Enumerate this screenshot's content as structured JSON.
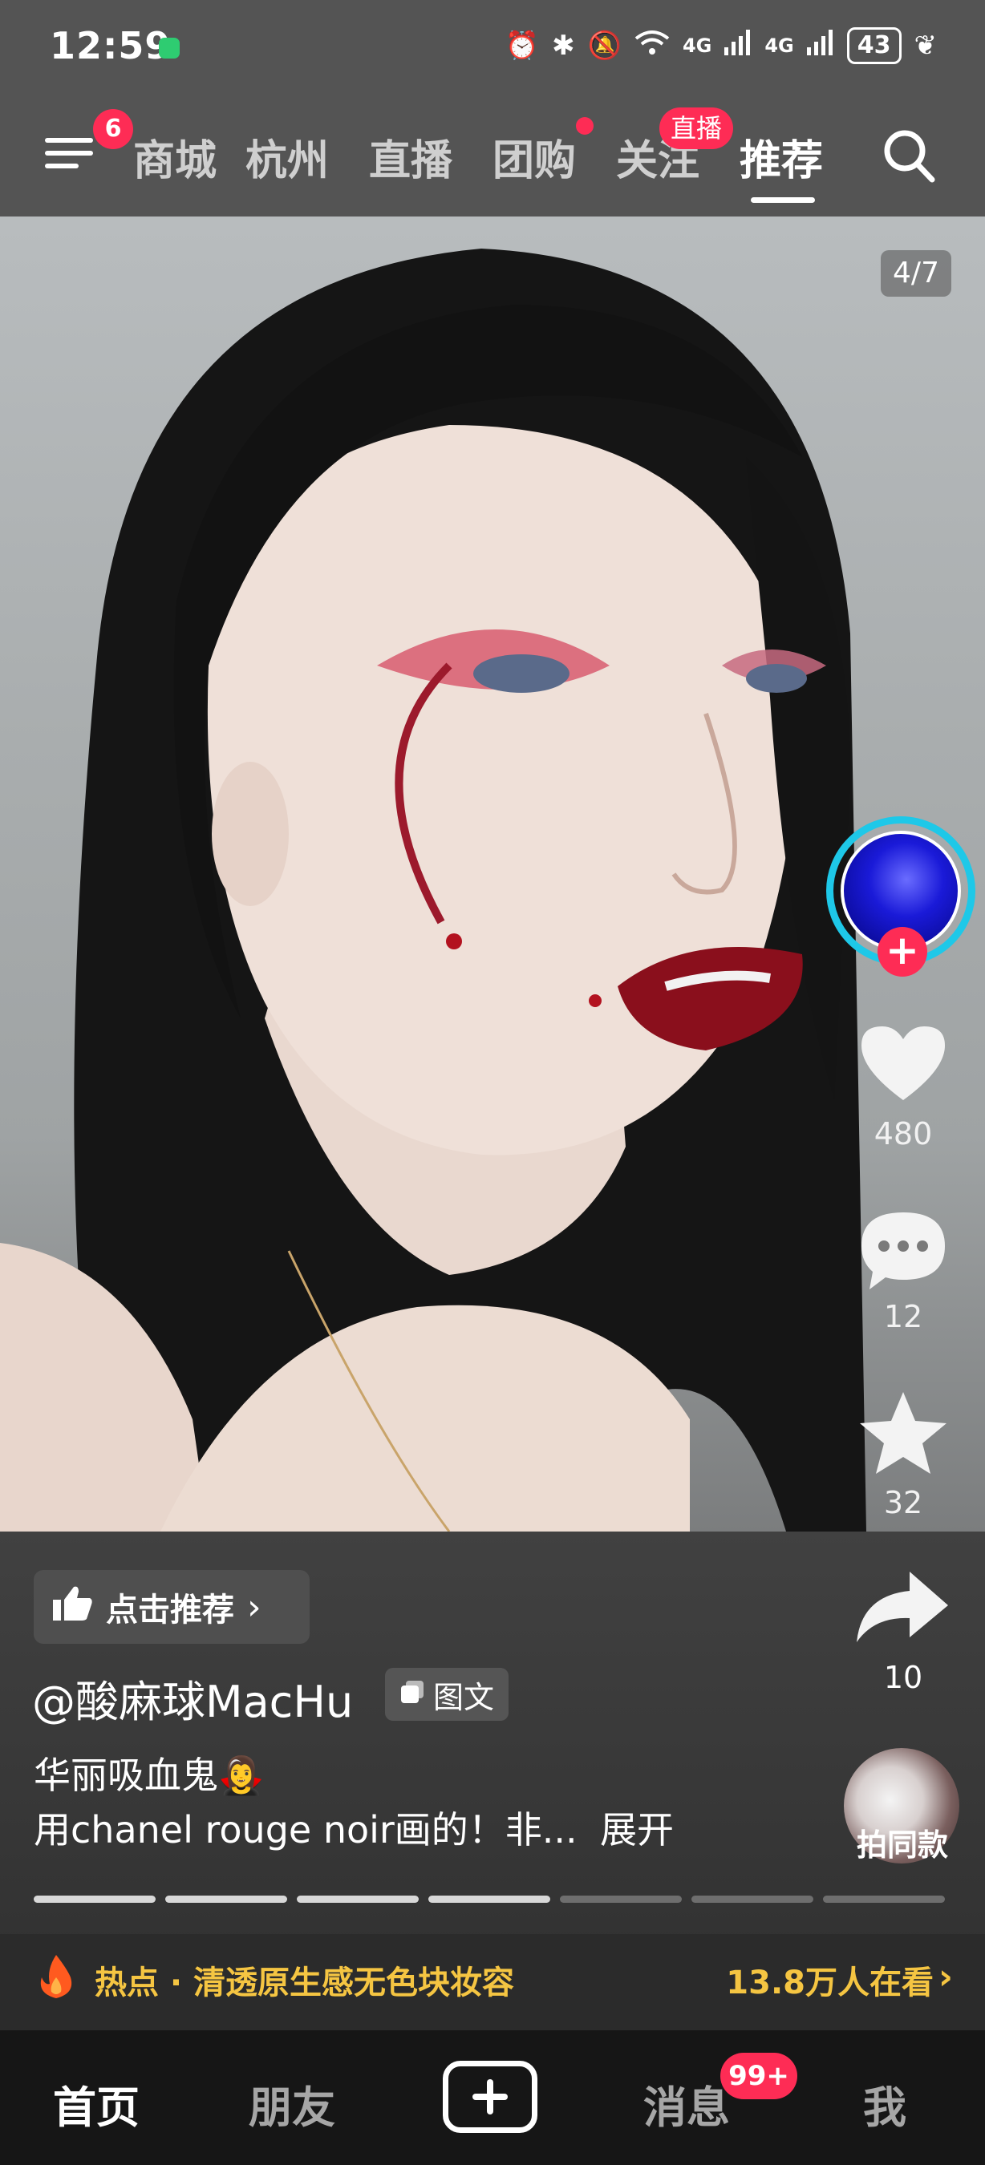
{
  "status_bar": {
    "time": "12:59",
    "battery": "43",
    "network_1": "4G",
    "network_2": "4G",
    "icons": [
      "wechat-icon",
      "alarm-icon",
      "bluetooth-icon",
      "mute-icon",
      "wifi-icon",
      "signal-icon",
      "battery-icon",
      "leaf-icon"
    ]
  },
  "top_nav": {
    "menu_badge": "6",
    "tabs": [
      {
        "label": "商城"
      },
      {
        "label": "杭州"
      },
      {
        "label": "直播"
      },
      {
        "label": "团购"
      },
      {
        "label": "关注"
      },
      {
        "label": "推荐"
      }
    ],
    "live_badge": "直播",
    "active_tab": "推荐"
  },
  "post": {
    "page_counter": "4/7",
    "author": "@酸麻球MacHu",
    "post_type": "图文",
    "caption_line1": "华丽吸血鬼🧛‍♀️",
    "caption_line2": "用chanel rouge noir画的！非...",
    "expand_label": "展开",
    "recommend_label": "点击推荐",
    "image_count": 7,
    "image_index": 4
  },
  "actions": {
    "likes": "480",
    "comments": "12",
    "favorites": "32",
    "shares": "10",
    "same_style_label": "拍同款"
  },
  "hot_topic": {
    "label": "热点 · 清透原生感无色块妆容",
    "viewers": "13.8万人在看"
  },
  "bottom_nav": {
    "home": "首页",
    "friends": "朋友",
    "messages": "消息",
    "messages_badge": "99+",
    "me": "我"
  },
  "colors": {
    "accent": "#fe2c55",
    "hot": "#f5c542",
    "avatar_ring": "#1ec8e8"
  }
}
